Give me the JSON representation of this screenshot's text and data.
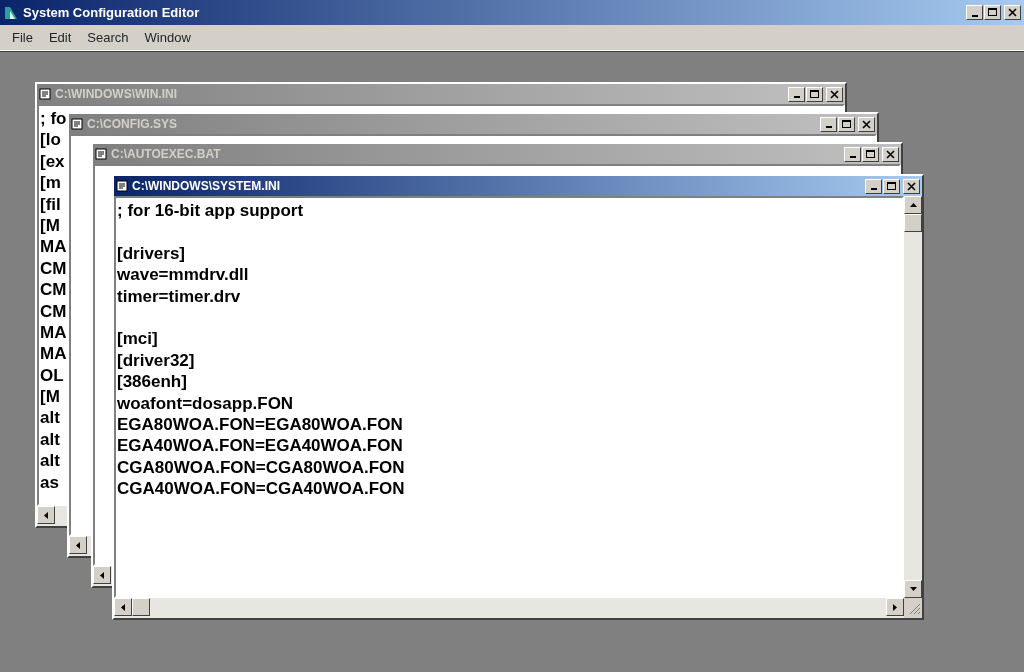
{
  "app": {
    "title": "System Configuration Editor"
  },
  "menu": [
    {
      "label": "File"
    },
    {
      "label": "Edit"
    },
    {
      "label": "Search"
    },
    {
      "label": "Window"
    }
  ],
  "documents": [
    {
      "title": "C:\\WINDOWS\\WIN.INI",
      "active": false,
      "lines": [
        {
          "text": "; fo"
        },
        {
          "text": "[lo"
        },
        {
          "text": "[ex"
        },
        {
          "text": "[m"
        },
        {
          "text": "[fil"
        },
        {
          "text": "[M"
        },
        {
          "text": "MA"
        },
        {
          "text": "CM"
        },
        {
          "text": "CM"
        },
        {
          "text": "CM"
        },
        {
          "text": "MA"
        },
        {
          "text": "MA"
        },
        {
          "text": "OL"
        },
        {
          "text": "[M"
        },
        {
          "text": "alt"
        },
        {
          "text": "alt"
        },
        {
          "text": "alt"
        },
        {
          "text": "as"
        }
      ]
    },
    {
      "title": "C:\\CONFIG.SYS",
      "active": false
    },
    {
      "title": "C:\\AUTOEXEC.BAT",
      "active": false
    },
    {
      "title": "C:\\WINDOWS\\SYSTEM.INI",
      "active": true,
      "lines": [
        {
          "text": "; for 16-bit app support"
        },
        {
          "text": "[drivers]",
          "blank_before": true
        },
        {
          "text": "wave=mmdrv.dll"
        },
        {
          "text": "timer=timer.drv"
        },
        {
          "text": "[mci]",
          "blank_before": true
        },
        {
          "text": "[driver32]"
        },
        {
          "text": "[386enh]"
        },
        {
          "text": "woafont=dosapp.FON"
        },
        {
          "text": "EGA80WOA.FON=EGA80WOA.FON"
        },
        {
          "text": "EGA40WOA.FON=EGA40WOA.FON"
        },
        {
          "text": "CGA80WOA.FON=CGA80WOA.FON"
        },
        {
          "text": "CGA40WOA.FON=CGA40WOA.FON"
        }
      ]
    }
  ]
}
